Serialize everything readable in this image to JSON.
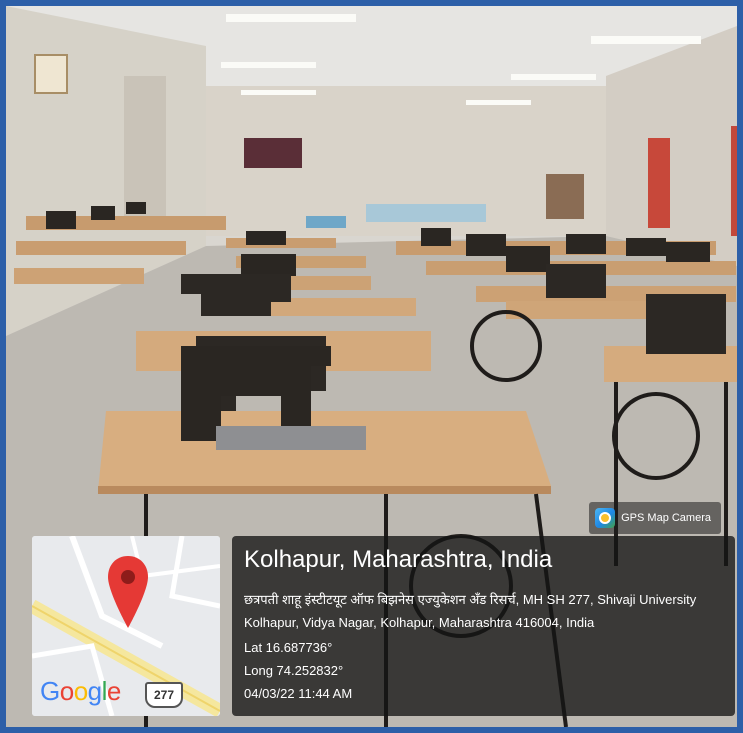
{
  "app_badge": {
    "icon": "gps-map-camera-icon",
    "label": "GPS Map Camera"
  },
  "location": {
    "place": "Kolhapur, Maharashtra, India",
    "address": "छत्रपती शाहू इंस्टीटयूट ऑफ बिझनेस एज्युकेशन अँड रिसर्च, MH SH 277, Shivaji University Kolhapur, Vidya Nagar, Kolhapur, Maharashtra 416004, India",
    "lat": "Lat 16.687736°",
    "long": "Long 74.252832°",
    "datetime": "04/03/22 11:44 AM"
  },
  "map": {
    "logo": "Google",
    "road_shield": "277",
    "pin_icon": "map-pin-icon"
  },
  "colors": {
    "frame": "#2d5fa8",
    "pin": "#e53935"
  }
}
